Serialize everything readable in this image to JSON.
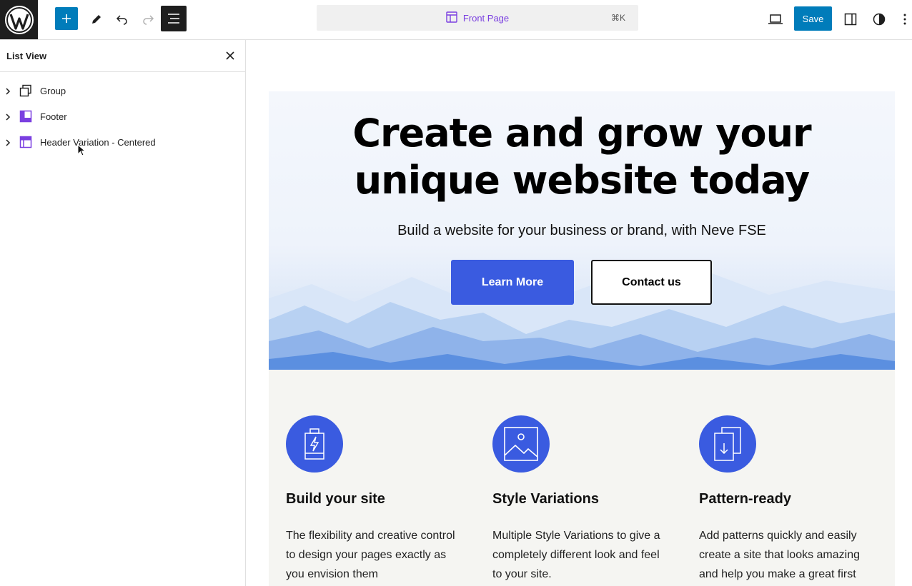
{
  "toolbar": {
    "document_title": "Front Page",
    "shortcut": "⌘K",
    "save_label": "Save"
  },
  "sidebar": {
    "title": "List View",
    "items": [
      {
        "label": "Group",
        "icon": "group-icon"
      },
      {
        "label": "Footer",
        "icon": "template-part-footer-icon"
      },
      {
        "label": "Header Variation - Centered",
        "icon": "template-part-header-icon"
      }
    ]
  },
  "hero": {
    "title_line1": "Create and grow your",
    "title_line2": "unique website today",
    "subtitle": "Build a website for your business or brand, with Neve FSE",
    "primary_button": "Learn More",
    "secondary_button": "Contact us"
  },
  "features": [
    {
      "icon": "battery-bolt-icon",
      "title": "Build your site",
      "desc": "The flexibility and creative control to design your pages exactly as you envision them"
    },
    {
      "icon": "image-icon",
      "title": "Style Variations",
      "desc": "Multiple Style Variations to give a completely different look and feel to your site."
    },
    {
      "icon": "document-download-icon",
      "title": "Pattern-ready",
      "desc": "Add patterns quickly and easily create a site that looks amazing and help you make a great first"
    }
  ],
  "colors": {
    "accent": "#3a5be0",
    "wp_blue": "#007cba",
    "template_purple": "#7a3fe0"
  }
}
